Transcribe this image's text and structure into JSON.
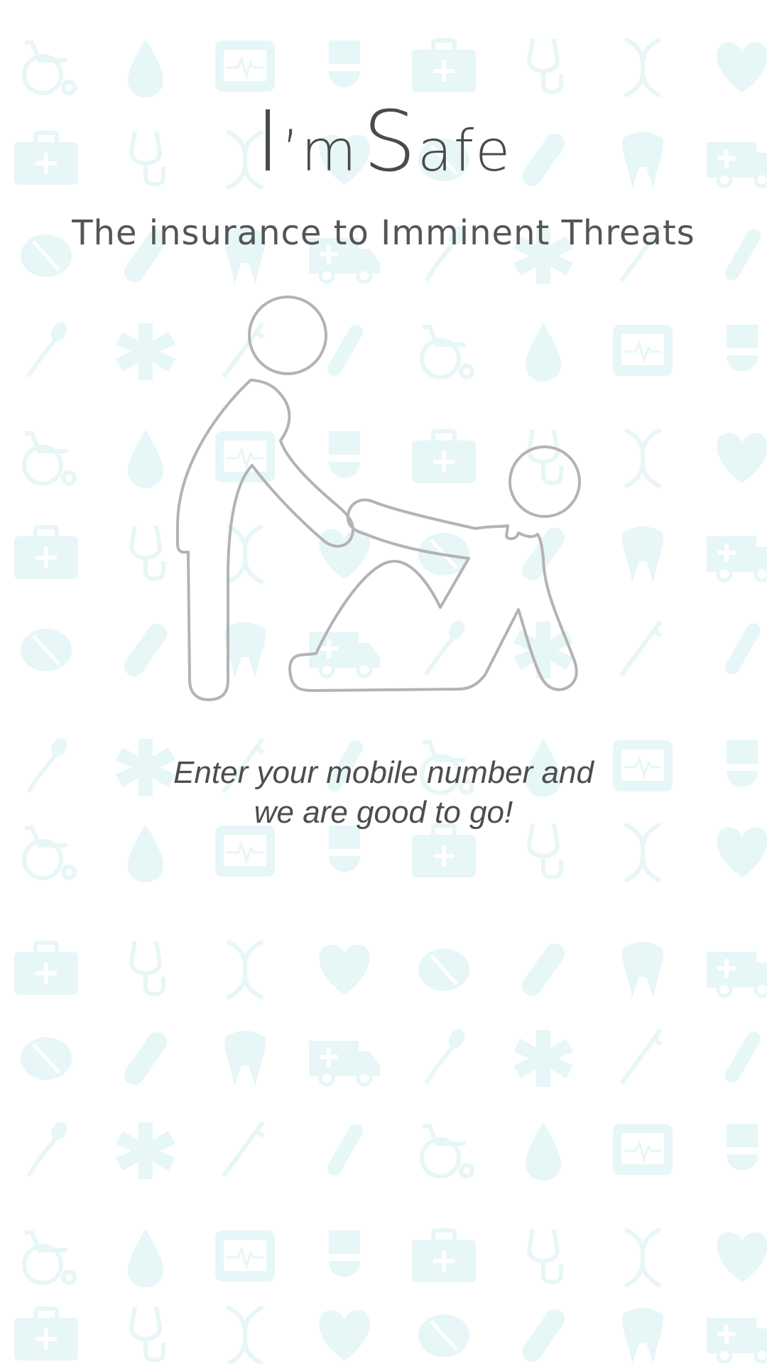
{
  "app": {
    "title_part1_big": "I",
    "title_part1_small": "’m",
    "title_part2_big": "S",
    "title_part2_small": "afe",
    "tagline": "The insurance to Imminent Threats"
  },
  "illustration": {
    "icon": "person-helping-fallen-person-icon",
    "stroke_color": "#b3b3b3"
  },
  "instruction": {
    "line1": "Enter your mobile number and",
    "line2": "we are good to go!"
  },
  "background": {
    "pattern_color": "#e6f6f6",
    "icons": [
      "wheelchair-icon",
      "drop-icon",
      "monitor-icon",
      "nurse-icon",
      "medkit-icon",
      "stethoscope-icon",
      "dna-icon",
      "heart-icon",
      "pill-icon",
      "capsule-icon",
      "tooth-icon",
      "ambulance-icon",
      "sperm-icon",
      "medical-star-icon",
      "syringe-icon",
      "test-tube-icon"
    ]
  }
}
